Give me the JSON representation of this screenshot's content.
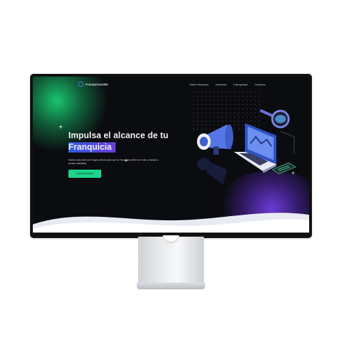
{
  "nav": {
    "logo": "Franquicias360",
    "links": [
      "Sobre Nosotros",
      "Servicios",
      "Franquicias",
      "Contacto"
    ]
  },
  "hero": {
    "title_line1": "Impulsa el alcance de tu",
    "title_line2": "Franquicia",
    "description": "Nuestro sitio web es el lugar perfecto para que tu Franquicia brille en el sitio y, trabaje a pensar visibilidad.",
    "cta": "CONTACTANOS"
  },
  "icons": [
    "logo-icon",
    "megaphone-icon",
    "laptop-icon",
    "magnifier-icon",
    "sparkle-icon"
  ],
  "colors": {
    "background": "#0b0c10",
    "accent_green": "#1ed38a",
    "accent_blue": "#2d5cdf",
    "accent_purple": "#6a3dd8"
  }
}
